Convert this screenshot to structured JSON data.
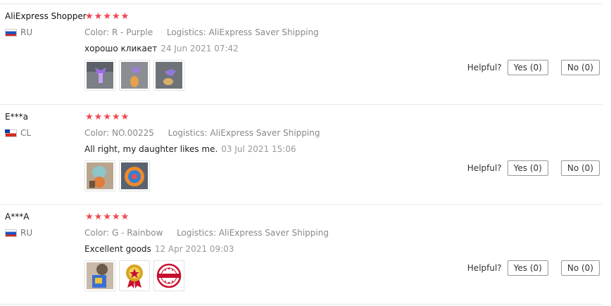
{
  "labels": {
    "color_prefix": "Color:",
    "logistics_prefix": "Logistics:",
    "helpful": "Helpful?"
  },
  "colors": {
    "star": "#f0474e"
  },
  "reviews": [
    {
      "user": "AliExpress Shopper",
      "country": "RU",
      "flag": "russia-flag",
      "rating": 5,
      "color": "R - Purple",
      "logistics": "AliExpress Saver Shipping",
      "text": "хорошо кликает",
      "date": "24 Jun 2021 07:42",
      "photos": [
        "product-photo",
        "product-photo",
        "product-photo"
      ],
      "yes": "Yes (0)",
      "no": "No (0)"
    },
    {
      "user": "E***a",
      "country": "CL",
      "flag": "chile-flag",
      "rating": 5,
      "color": "NO.00225",
      "logistics": "AliExpress Saver Shipping",
      "text": "All right, my daughter likes me.",
      "date": "03 Jul 2021 15:06",
      "photos": [
        "product-photo",
        "product-photo"
      ],
      "yes": "Yes (0)",
      "no": "No (0)"
    },
    {
      "user": "A***A",
      "country": "RU",
      "flag": "russia-flag",
      "rating": 5,
      "color": "G - Rainbow",
      "logistics": "AliExpress Saver Shipping",
      "text": "Excellent goods",
      "date": "12 Apr 2021 09:03",
      "photos": [
        "product-photo",
        "award-badge",
        "recommended-stamp"
      ],
      "yes": "Yes (0)",
      "no": "No (0)"
    }
  ]
}
